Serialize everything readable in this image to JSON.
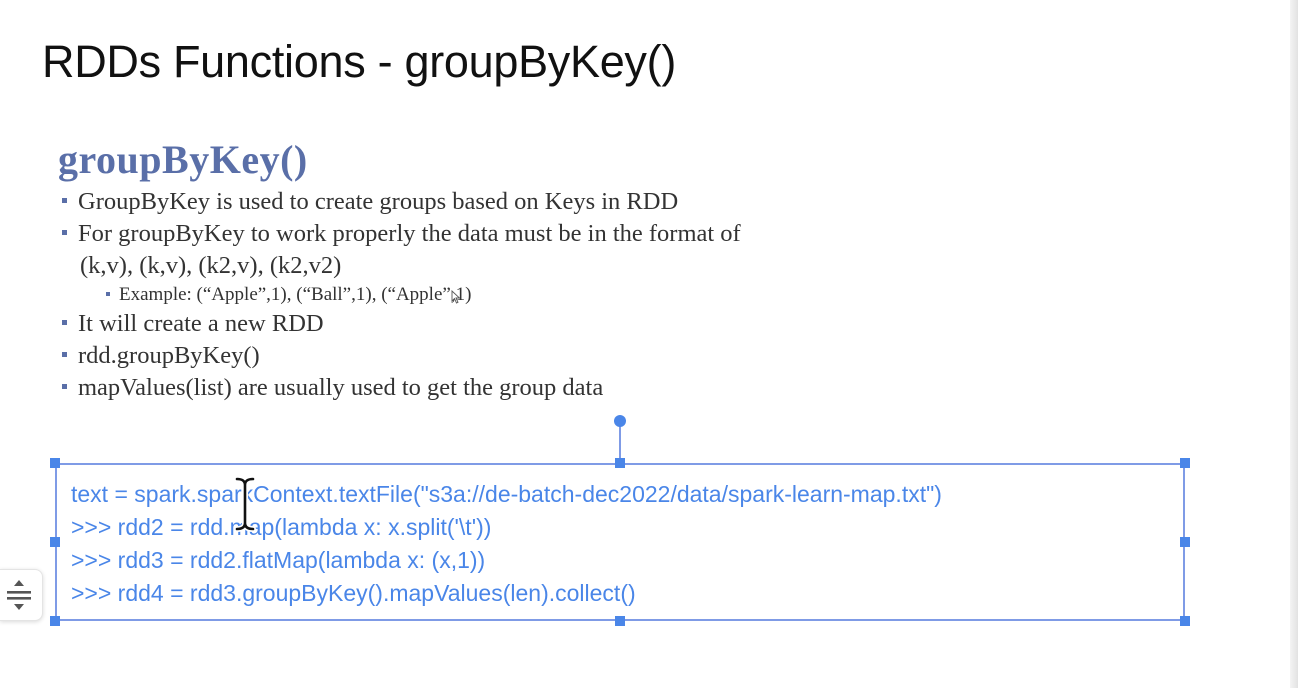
{
  "slide": {
    "title": "RDDs Functions - groupByKey()"
  },
  "content": {
    "heading": "groupByKey()",
    "bullets": [
      "GroupByKey is used to create groups based on Keys in RDD",
      "For groupByKey to work properly the data must be in the format of",
      "(k,v), (k,v), (k2,v), (k2,v2)",
      "Example: (“Apple”,1), (“Ball”,1), (“Apple”,1)",
      "It will create a new RDD",
      "rdd.groupByKey()",
      "mapValues(list) are usually used to get the group data"
    ]
  },
  "code_box": {
    "lines": [
      "text = spark.sparkContext.textFile(\"s3a://de-batch-dec2022/data/spark-learn-map.txt\")",
      ">>> rdd2 = rdd.map(lambda x: x.split('\\t'))",
      ">>> rdd3 = rdd2.flatMap(lambda x: (x,1))",
      ">>> rdd4 = rdd3.groupByKey().mapValues(len).collect()"
    ]
  },
  "icons": {
    "side_tool": "drag-handle-icon",
    "cursor": "text-cursor-icon",
    "mouse": "arrow-pointer-icon"
  },
  "colors": {
    "heading": "#5a6fa8",
    "code_text": "#4a86e8",
    "selection": "#4a86e8"
  }
}
